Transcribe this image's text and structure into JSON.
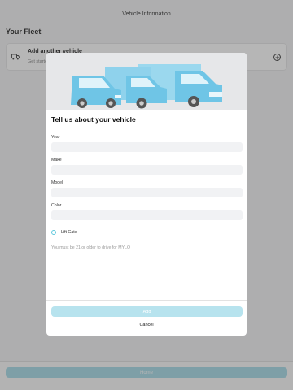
{
  "header": {
    "title": "Vehicle Information"
  },
  "fleet": {
    "title": "Your Fleet",
    "add_title": "Add another vehicle",
    "add_subtitle": "Get started"
  },
  "footer": {
    "home_label": "Home"
  },
  "modal": {
    "title": "Tell us about your vehicle",
    "fields": [
      {
        "label": "Year",
        "value": ""
      },
      {
        "label": "Make",
        "value": ""
      },
      {
        "label": "Model",
        "value": ""
      },
      {
        "label": "Color",
        "value": ""
      }
    ],
    "lift_gate_label": "Lift Gate",
    "lift_gate_checked": false,
    "age_note": "You must be 21 or older to drive for MYLO",
    "add_label": "Add",
    "cancel_label": "Cancel"
  },
  "colors": {
    "accent": "#5cc7dc",
    "accent_light": "#b7e3ee",
    "truck_blue": "#6fc5e6",
    "truck_light": "#9bd8ee"
  },
  "icons": {
    "fleet_card": "truck-icon",
    "fleet_action": "plus-circle-icon",
    "hero": "trucks-illustration"
  }
}
